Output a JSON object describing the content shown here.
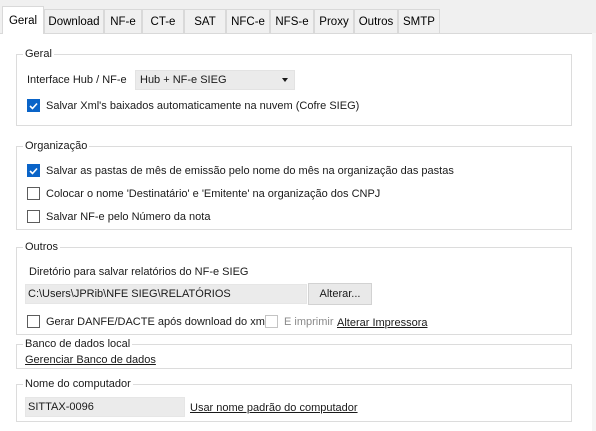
{
  "tabs": [
    {
      "label": "Geral",
      "active": true
    },
    {
      "label": "Download"
    },
    {
      "label": "NF-e"
    },
    {
      "label": "CT-e"
    },
    {
      "label": "SAT"
    },
    {
      "label": "NFC-e"
    },
    {
      "label": "NFS-e"
    },
    {
      "label": "Proxy"
    },
    {
      "label": "Outros"
    },
    {
      "label": "SMTP"
    }
  ],
  "geral": {
    "legend": "Geral",
    "interface_label": "Interface Hub / NF-e",
    "interface_value": "Hub + NF-e SIEG",
    "salvar_xml": {
      "label": "Salvar Xml's baixados automaticamente na nuvem (Cofre SIEG)",
      "checked": true
    }
  },
  "organizacao": {
    "legend": "Organização",
    "options": [
      {
        "label": "Salvar as pastas de mês de emissão pelo nome do mês na organização das pastas",
        "checked": true
      },
      {
        "label": "Colocar o nome 'Destinatário' e 'Emitente' na organização dos CNPJ",
        "checked": false
      },
      {
        "label": "Salvar NF-e pelo Número da nota",
        "checked": false
      }
    ]
  },
  "outros": {
    "legend": "Outros",
    "diretorio_label": "Diretório para salvar relatórios do NF-e SIEG",
    "diretorio_value": "C:\\Users\\JPRib\\NFE SIEG\\RELATÓRIOS",
    "alterar_button": "Alterar...",
    "gerar_danfe": {
      "label": "Gerar DANFE/DACTE após download do xml",
      "checked": false
    },
    "e_imprimir": {
      "label": "E imprimir",
      "checked": false,
      "disabled": true
    },
    "alterar_impressora_link": "Alterar Impressora"
  },
  "banco": {
    "legend": "Banco de dados local",
    "gerenciar_link": "Gerenciar Banco de dados"
  },
  "computador": {
    "legend": "Nome do computador",
    "nome_value": "SITTAX-0096",
    "usar_padrao_link": "Usar nome padrão do computador"
  },
  "colors": {
    "accent": "#0a64c8",
    "panel_bg": "#ffffff",
    "window_bg": "#f0f0f0"
  }
}
